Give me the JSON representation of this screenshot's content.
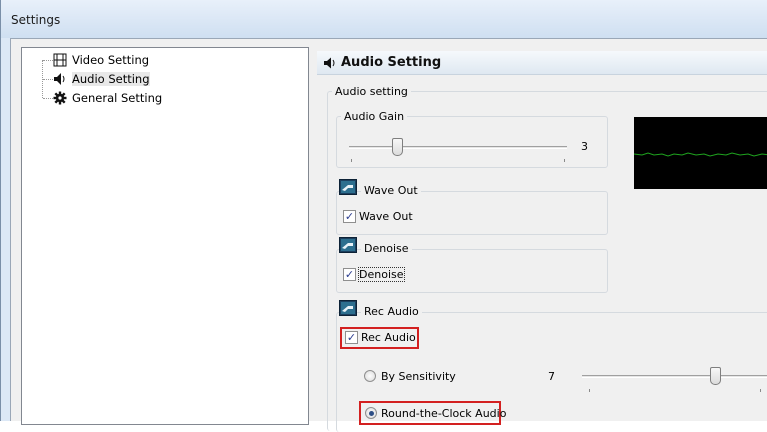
{
  "window": {
    "title": "Settings"
  },
  "tree": {
    "items": [
      {
        "label": "Video Setting",
        "icon": "film-icon"
      },
      {
        "label": "Audio Setting",
        "icon": "speaker-icon",
        "selected": true
      },
      {
        "label": "General Setting",
        "icon": "gear-icon"
      }
    ]
  },
  "panel": {
    "header": "Audio Setting",
    "audio_setting_group": "Audio setting",
    "audio_gain": {
      "label": "Audio Gain",
      "value": "3",
      "level": 0.22
    },
    "wave_out": {
      "group_label": "Wave Out",
      "checkbox_label": "Wave Out",
      "checked": true
    },
    "denoise": {
      "group_label": "Denoise",
      "checkbox_label": "Denoise",
      "checked": true
    },
    "rec_audio": {
      "group_label": "Rec Audio",
      "checkbox_label": "Rec Audio",
      "checked": true,
      "by_sensitivity": {
        "label": "By Sensitivity",
        "value": "7",
        "selected": false,
        "level": 0.7
      },
      "round_the_clock": {
        "label": "Round-the-Clock Audio",
        "selected": true
      }
    }
  },
  "colors": {
    "highlight": "#d32020",
    "waveform": "#1fa51f",
    "scope_bg": "#000000"
  }
}
